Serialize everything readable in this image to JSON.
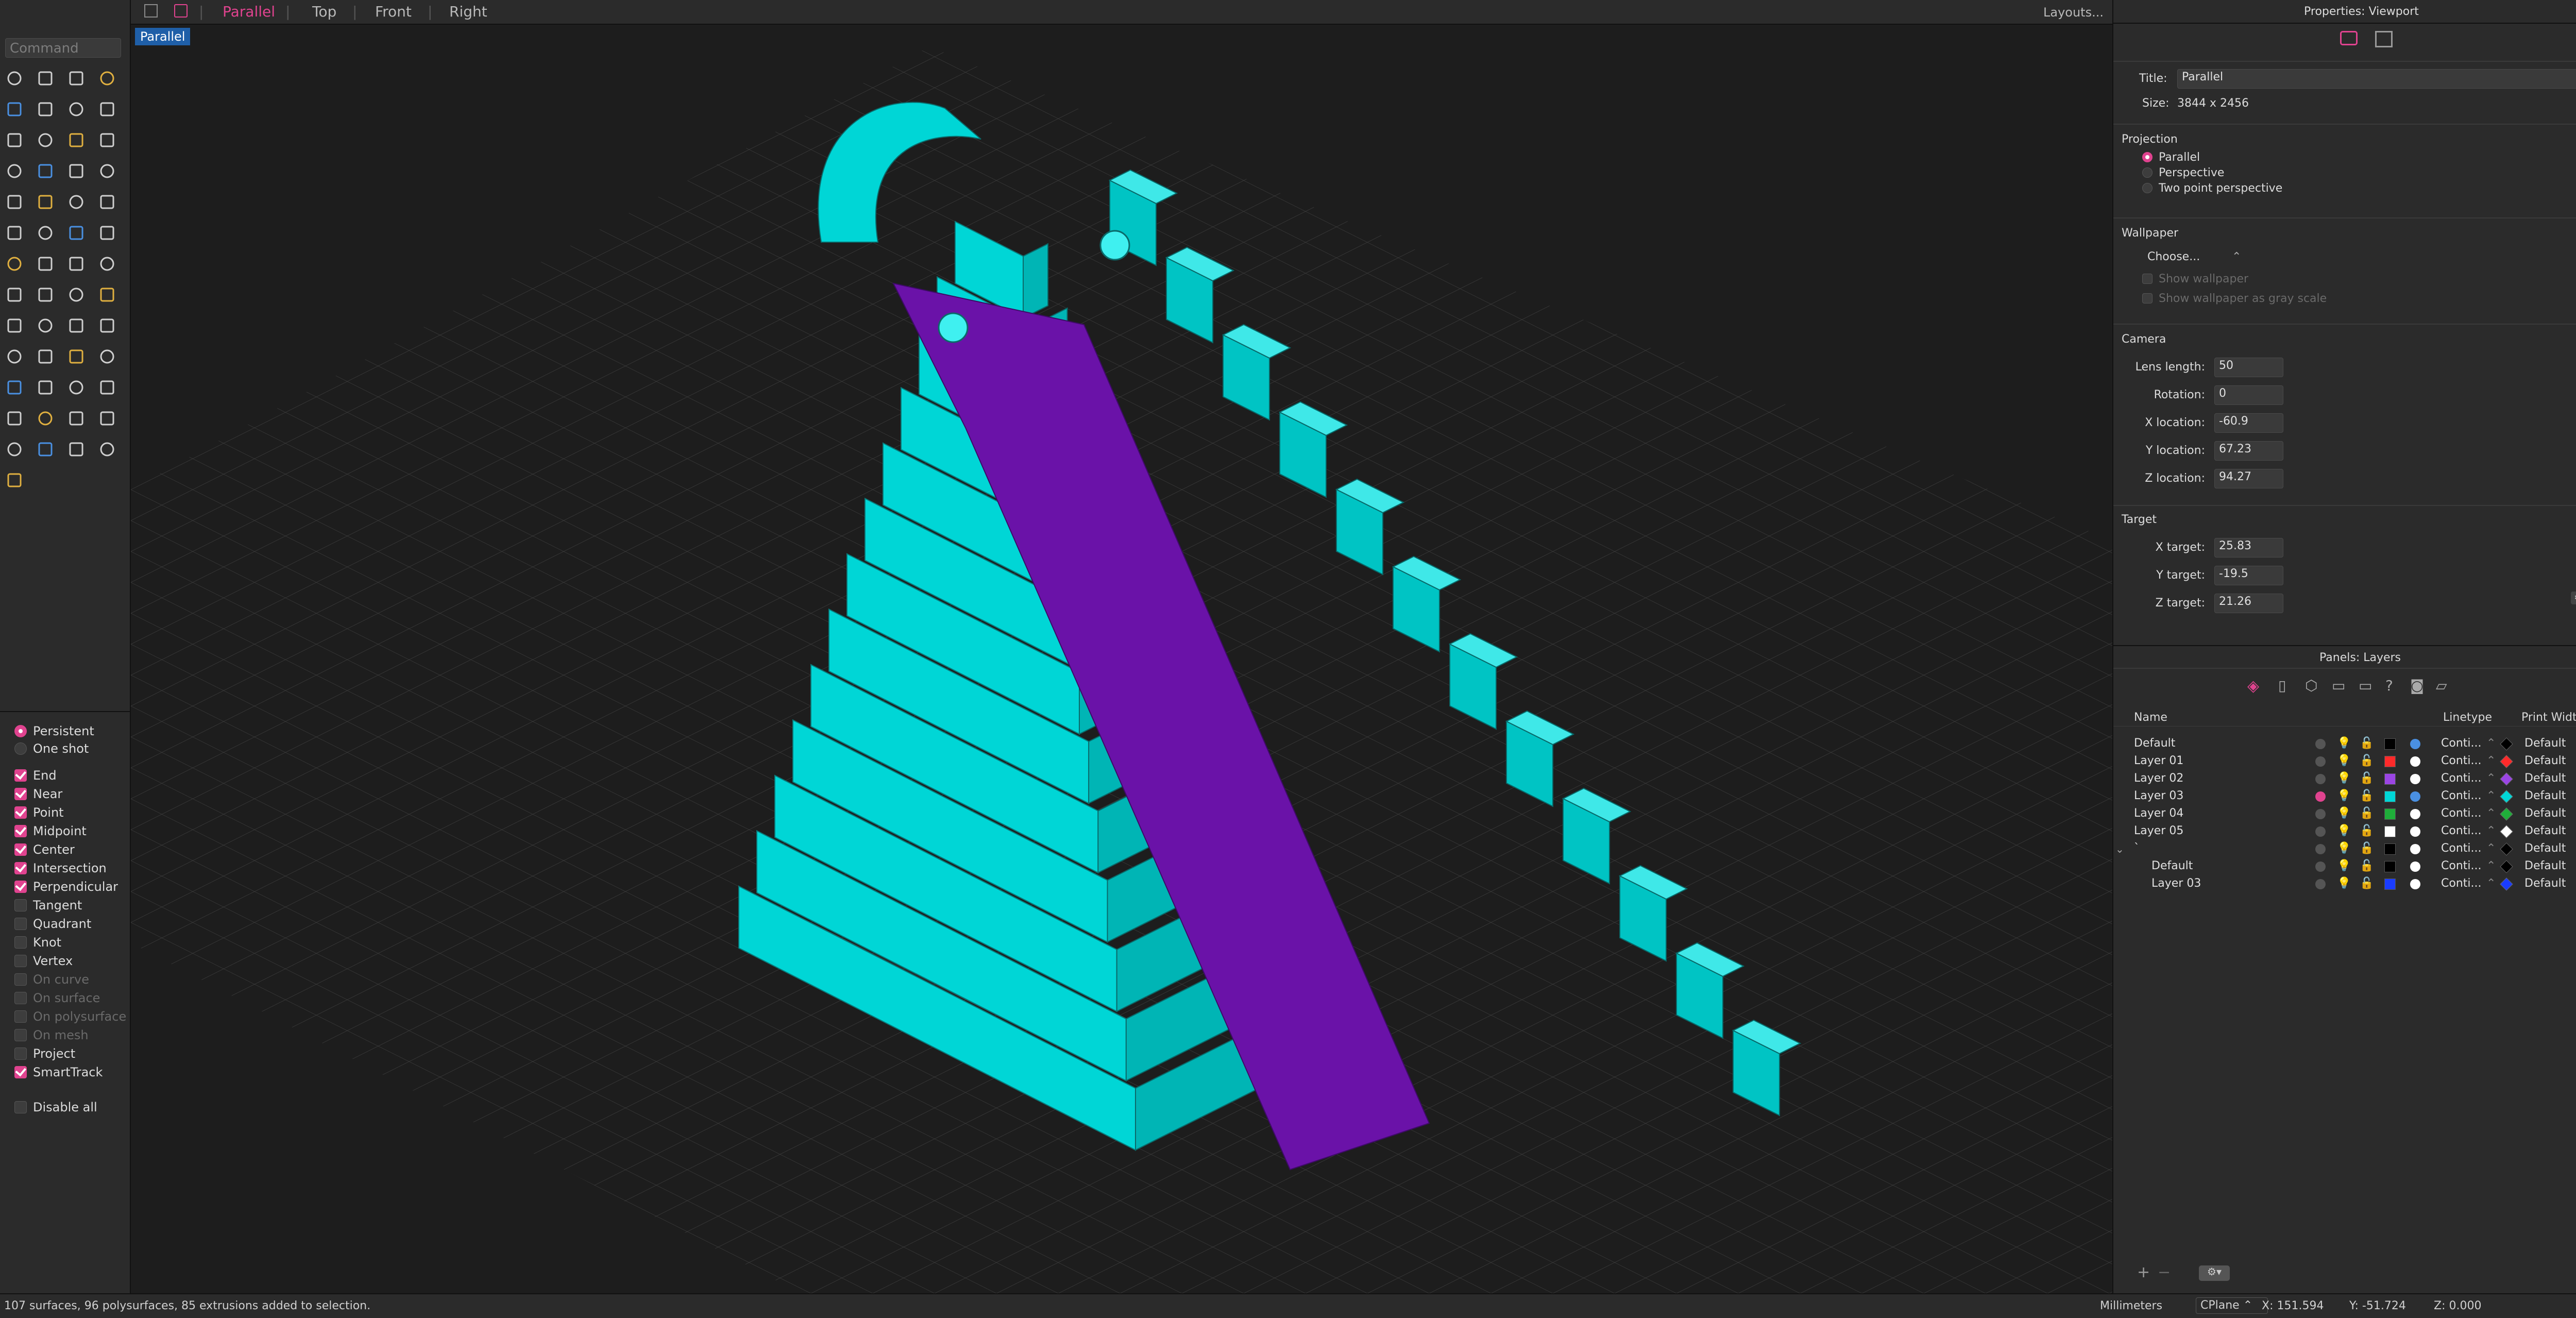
{
  "command": {
    "placeholder": "Command"
  },
  "topbar": {
    "tabs": [
      {
        "label": "Parallel",
        "active": true
      },
      {
        "label": "Top",
        "active": false
      },
      {
        "label": "Front",
        "active": false
      },
      {
        "label": "Right",
        "active": false
      }
    ],
    "layouts_label": "Layouts..."
  },
  "viewport": {
    "title": "Parallel",
    "accent": "#1f5fa8",
    "model_color": "#00d6d6",
    "ramp_color": "#6a12a8"
  },
  "osnap": {
    "modes": [
      {
        "label": "Persistent",
        "on": true
      },
      {
        "label": "One shot",
        "on": false
      }
    ],
    "items": [
      {
        "label": "End",
        "on": true
      },
      {
        "label": "Near",
        "on": true
      },
      {
        "label": "Point",
        "on": true
      },
      {
        "label": "Midpoint",
        "on": true
      },
      {
        "label": "Center",
        "on": true
      },
      {
        "label": "Intersection",
        "on": true
      },
      {
        "label": "Perpendicular",
        "on": true
      },
      {
        "label": "Tangent",
        "on": false
      },
      {
        "label": "Quadrant",
        "on": false
      },
      {
        "label": "Knot",
        "on": false
      },
      {
        "label": "Vertex",
        "on": false
      },
      {
        "label": "On curve",
        "on": false,
        "disabled": true
      },
      {
        "label": "On surface",
        "on": false,
        "disabled": true
      },
      {
        "label": "On polysurface",
        "on": false,
        "disabled": true
      },
      {
        "label": "On mesh",
        "on": false,
        "disabled": true
      },
      {
        "label": "Project",
        "on": false
      },
      {
        "label": "SmartTrack",
        "on": true
      }
    ],
    "disable_all": "Disable all"
  },
  "properties": {
    "header": "Properties: Viewport",
    "title_label": "Title:",
    "title_value": "Parallel",
    "size_label": "Size:",
    "size_value": "3844 x 2456",
    "projection_head": "Projection",
    "projections": [
      {
        "label": "Parallel",
        "on": true
      },
      {
        "label": "Perspective",
        "on": false
      },
      {
        "label": "Two point perspective",
        "on": false
      }
    ],
    "wallpaper_head": "Wallpaper",
    "wallpaper_choose": "Choose...",
    "show_wallpaper": "Show wallpaper",
    "show_gray": "Show wallpaper as gray scale",
    "camera_head": "Camera",
    "camera": [
      {
        "label": "Lens length:",
        "value": "50"
      },
      {
        "label": "Rotation:",
        "value": "0"
      },
      {
        "label": "X location:",
        "value": "-60.9"
      },
      {
        "label": "Y location:",
        "value": "67.23"
      },
      {
        "label": "Z location:",
        "value": "94.27"
      }
    ],
    "target_head": "Target",
    "target": [
      {
        "label": "X target:",
        "value": "25.83"
      },
      {
        "label": "Y target:",
        "value": "-19.5"
      },
      {
        "label": "Z target:",
        "value": "21.26"
      }
    ]
  },
  "layers": {
    "header": "Panels: Layers",
    "col_name": "Name",
    "col_linetype": "Linetype",
    "col_printwidth": "Print Width",
    "rows": [
      {
        "name": "Default",
        "current": false,
        "color": "#000000",
        "mat": "#4a90e2",
        "print": "#000000",
        "linetype": "Conti...",
        "width": "Default",
        "indent": false
      },
      {
        "name": "Layer 01",
        "current": false,
        "color": "#ff2a2a",
        "mat": "#ffffff",
        "print": "#ff2a2a",
        "linetype": "Conti...",
        "width": "Default",
        "indent": false
      },
      {
        "name": "Layer 02",
        "current": false,
        "color": "#9b45e4",
        "mat": "#ffffff",
        "print": "#9b45e4",
        "linetype": "Conti...",
        "width": "Default",
        "indent": false
      },
      {
        "name": "Layer 03",
        "current": true,
        "color": "#00d6d6",
        "mat": "#4a90e2",
        "print": "#00d6d6",
        "linetype": "Conti...",
        "width": "Default",
        "indent": false
      },
      {
        "name": "Layer 04",
        "current": false,
        "color": "#1fae3a",
        "mat": "#ffffff",
        "print": "#1fae3a",
        "linetype": "Conti...",
        "width": "Default",
        "indent": false
      },
      {
        "name": "Layer 05",
        "current": false,
        "color": "#ffffff",
        "mat": "#ffffff",
        "print": "#ffffff",
        "linetype": "Conti...",
        "width": "Default",
        "indent": false
      },
      {
        "name": "`",
        "current": false,
        "color": "#000000",
        "mat": "#ffffff",
        "print": "#000000",
        "linetype": "Conti...",
        "width": "Default",
        "indent": false
      },
      {
        "name": "Default",
        "current": false,
        "color": "#000000",
        "mat": "#ffffff",
        "print": "#000000",
        "linetype": "Conti...",
        "width": "Default",
        "indent": true
      },
      {
        "name": "Layer 03",
        "current": false,
        "color": "#1a3cff",
        "mat": "#ffffff",
        "print": "#1a3cff",
        "linetype": "Conti...",
        "width": "Default",
        "indent": true
      }
    ]
  },
  "status": {
    "message": "107 surfaces, 96 polysurfaces, 85 extrusions added to selection.",
    "units": "Millimeters",
    "cplane": "CPlane",
    "x": "X: 151.594",
    "y": "Y: -51.724",
    "z": "Z: 0.000"
  }
}
